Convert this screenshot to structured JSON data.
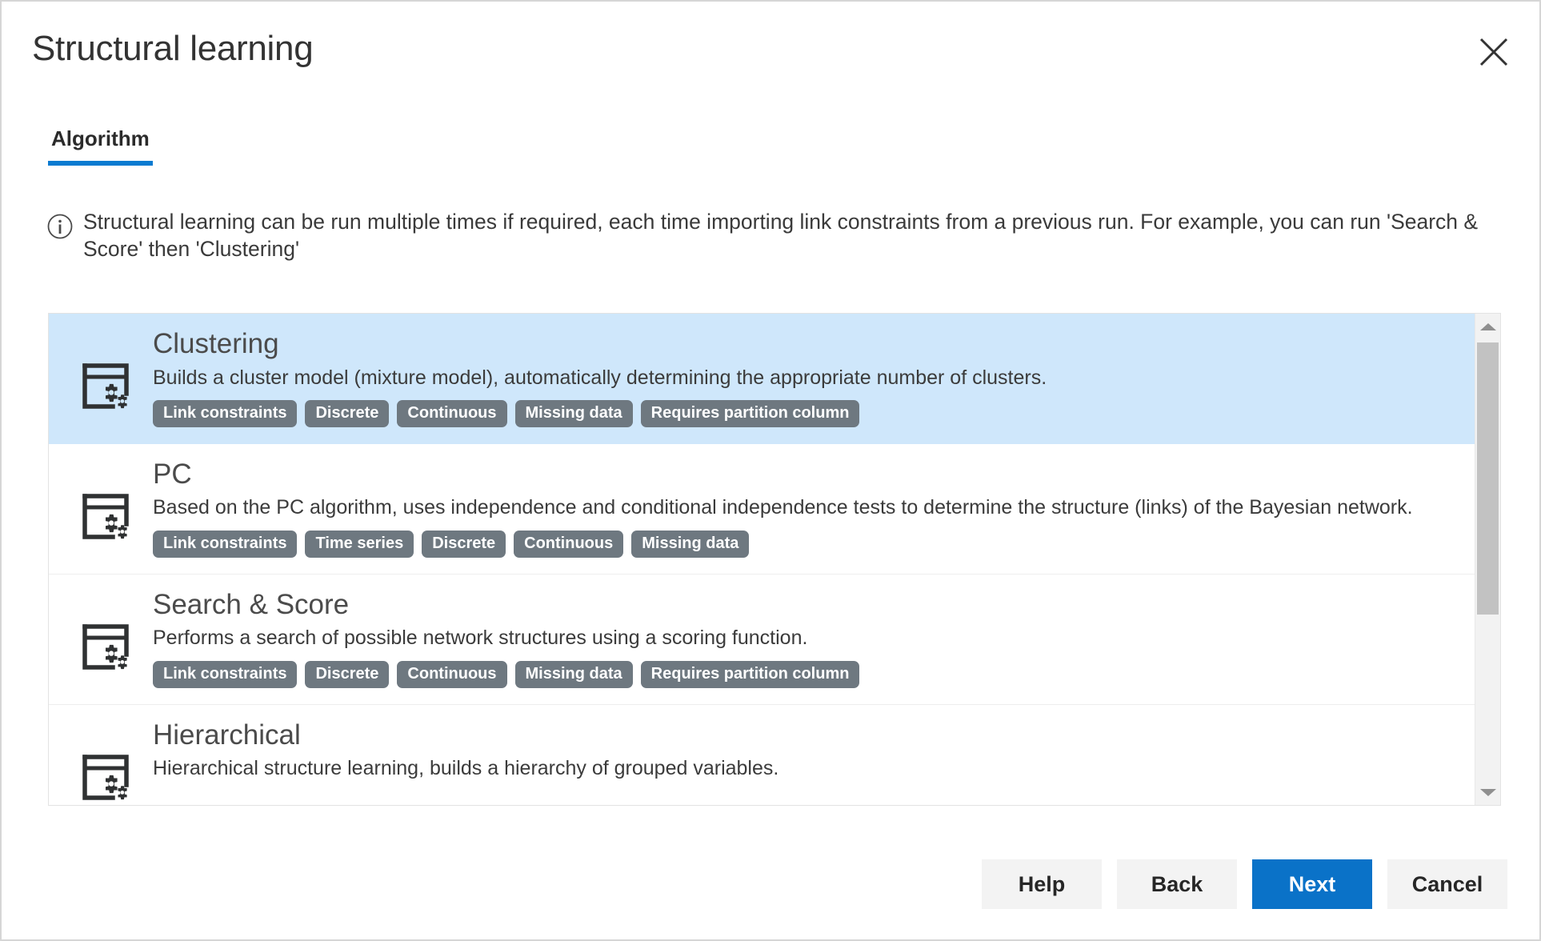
{
  "dialog": {
    "title": "Structural learning",
    "close_icon": "close-icon"
  },
  "tabs": [
    {
      "label": "Algorithm",
      "active": true
    }
  ],
  "info": {
    "icon": "info-circle-icon",
    "text": "Structural learning can be run multiple times if required, each time importing link constraints from a previous run. For example, you can run 'Search & Score' then 'Clustering'"
  },
  "algorithm_list": {
    "icon_name": "window-gears-icon",
    "items": [
      {
        "name": "Clustering",
        "description": "Builds a cluster model (mixture model), automatically determining the appropriate number of clusters.",
        "tags": [
          "Link constraints",
          "Discrete",
          "Continuous",
          "Missing data",
          "Requires partition column"
        ],
        "selected": true
      },
      {
        "name": "PC",
        "description": "Based on the PC algorithm, uses independence and conditional independence tests to determine the structure (links) of the Bayesian network.",
        "tags": [
          "Link constraints",
          "Time series",
          "Discrete",
          "Continuous",
          "Missing data"
        ],
        "selected": false
      },
      {
        "name": "Search & Score",
        "description": "Performs a search of possible network structures using a scoring function.",
        "tags": [
          "Link constraints",
          "Discrete",
          "Continuous",
          "Missing data",
          "Requires partition column"
        ],
        "selected": false
      },
      {
        "name": "Hierarchical",
        "description": "Hierarchical structure learning, builds a hierarchy of grouped variables.",
        "tags": [],
        "selected": false
      }
    ]
  },
  "scrollbar": {
    "up_icon": "chevron-up-icon",
    "down_icon": "chevron-down-icon"
  },
  "footer": {
    "help_label": "Help",
    "back_label": "Back",
    "next_label": "Next",
    "cancel_label": "Cancel"
  },
  "colors": {
    "accent": "#0a7bd1",
    "primary_button": "#0a72c8",
    "selected_row": "#cfe7fb",
    "tag": "#6e7880"
  }
}
